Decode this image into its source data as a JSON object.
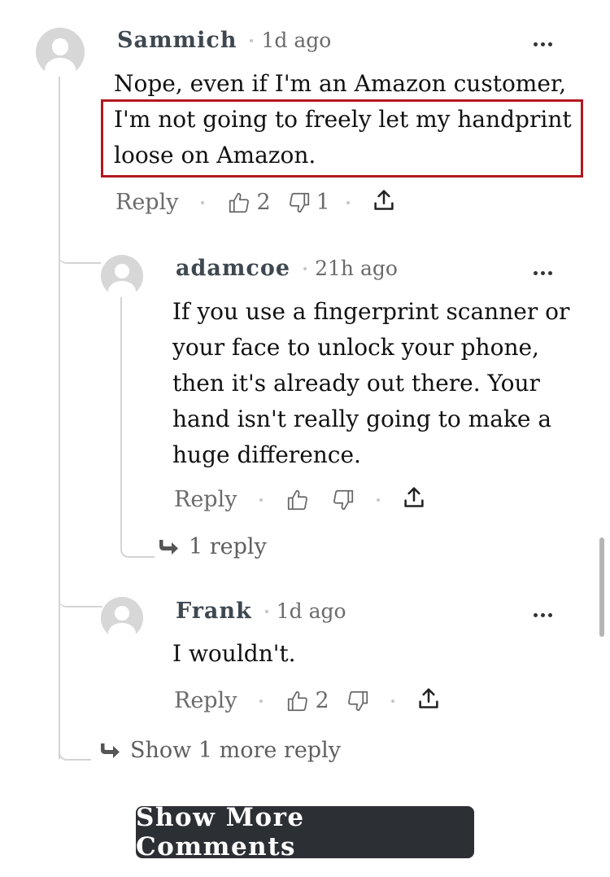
{
  "comments": [
    {
      "username": "Sammich",
      "age": "1d ago",
      "text": [
        "Nope, even if I'm an Amazon customer,",
        "I'm not going to freely let my handprint",
        "loose on Amazon."
      ],
      "reply_label": "Reply",
      "upvotes": "2",
      "downvotes": "1"
    },
    {
      "username": "adamcoe",
      "age": "21h ago",
      "text": [
        "If you use a fingerprint scanner or",
        "your face to unlock your phone,",
        "then it's already out there. Your",
        "hand isn't really going to make a",
        "huge difference."
      ],
      "reply_label": "Reply",
      "upvotes": "",
      "downvotes": "",
      "replies_label": "1 reply"
    },
    {
      "username": "Frank",
      "age": "1d ago",
      "text": [
        "I wouldn't."
      ],
      "reply_label": "Reply",
      "upvotes": "2",
      "downvotes": ""
    }
  ],
  "show_more_replies": "Show 1 more reply",
  "show_more_comments": "Show More Comments"
}
